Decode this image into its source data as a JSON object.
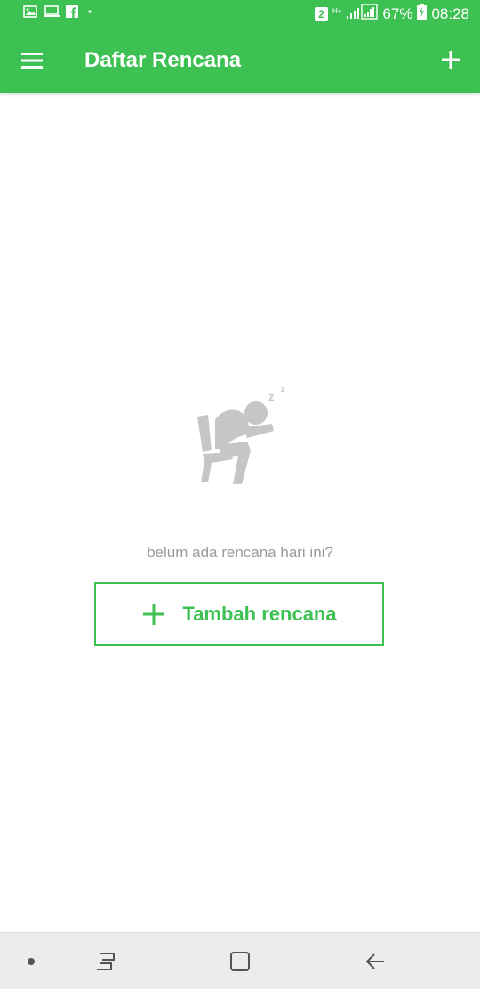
{
  "status_bar": {
    "sim_label": "2",
    "network_label": "H+",
    "battery_percent": "67%",
    "time": "08:28",
    "icons": [
      "gallery-icon",
      "screen-icon",
      "facebook-icon",
      "dot-icon",
      "signal-icon",
      "battery-icon"
    ]
  },
  "app_bar": {
    "title": "Daftar Rencana",
    "menu_icon": "hamburger-menu-icon",
    "action_icon": "plus-icon"
  },
  "empty_state": {
    "illustration": "sleeping-person-icon",
    "message": "belum ada rencana hari ini?",
    "button_label": "Tambah rencana",
    "button_icon": "plus-icon"
  },
  "nav_bar": {
    "icons": [
      "dot-icon",
      "recent-apps-icon",
      "home-icon",
      "back-icon"
    ]
  },
  "colors": {
    "accent": "#3ec153",
    "message_text": "#9a9a9a",
    "nav_background": "#ececec"
  }
}
